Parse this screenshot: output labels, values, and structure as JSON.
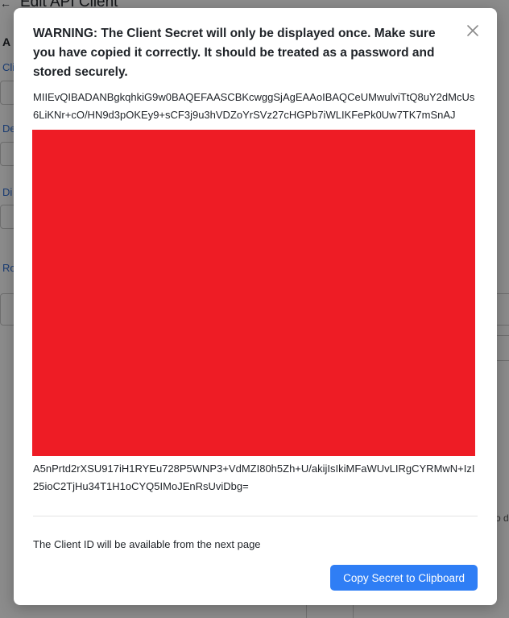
{
  "background": {
    "page_title": "Edit API Client",
    "back_icon": "arrow-left-icon",
    "side_fragments": [
      "A",
      "Cli",
      "De",
      "Di",
      "Ro"
    ],
    "right_fragment": "o d"
  },
  "modal": {
    "close_icon": "close-icon",
    "warning": "WARNING: The Client Secret will only be displayed once. Make sure you have copied it correctly. It should be treated as a password and stored securely.",
    "secret_head": "MIIEvQIBADANBgkqhkiG9w0BAQEFAASCBKcwggSjAgEAAoIBAQCeUMwulviTtQ8uY2dMcUs6LiKNr+cO/HN9d3pOKEy9+sCF3j9u3hVDZoYrSVz27cHGPb7iWLIKFePk0Uw7TK7mSnAJ",
    "secret_tail": "A5nPrtd2rXSU917iH1RYEu728P5WNP3+VdMZI80h5Zh+U/akijIsIkiMFaWUvLIRgCYRMwN+IzI25ioC2TjHu34T1H1oCYQ5IMoJEnRsUviDbg=",
    "client_id_note": "The Client ID will be available from the next page",
    "copy_button": "Copy Secret to Clipboard",
    "accent_color": "#2f7ef5",
    "redaction_color": "#ee1c25"
  }
}
